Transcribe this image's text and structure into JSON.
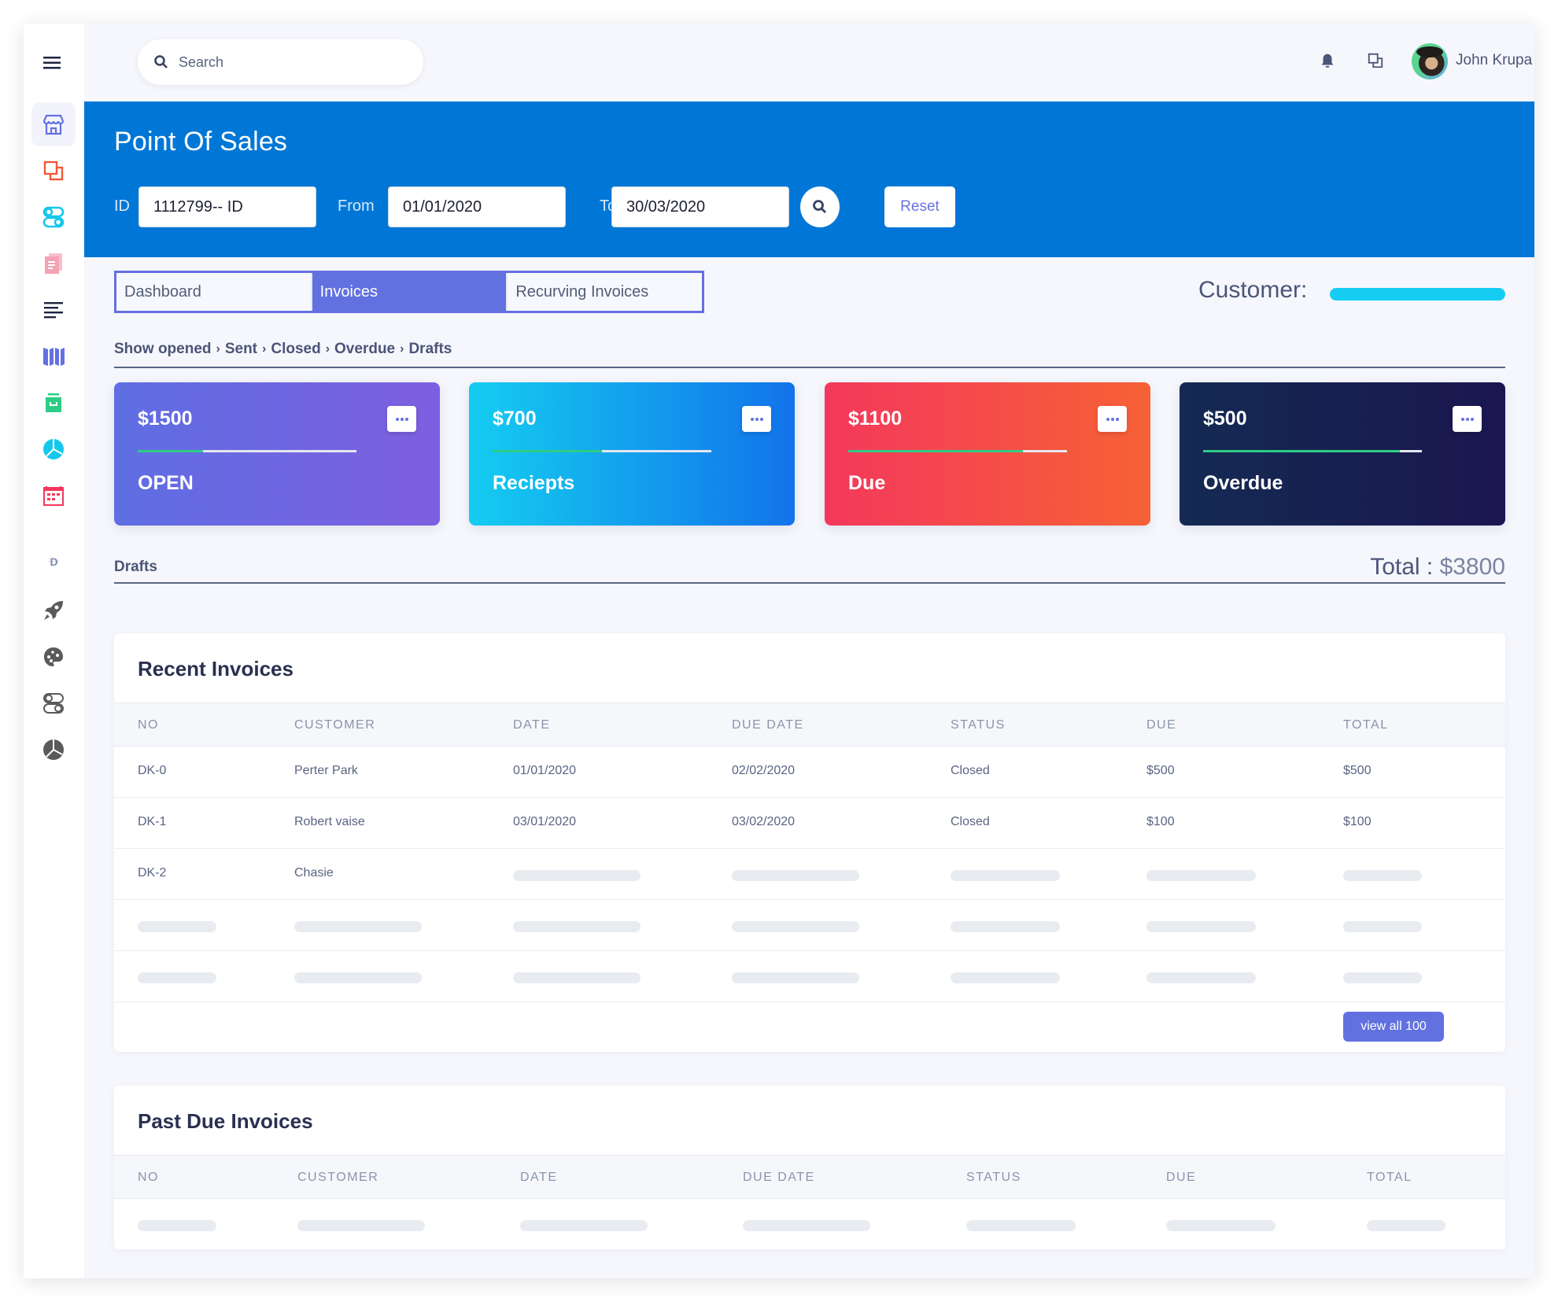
{
  "sidebar": {
    "menu_icon": "hamburger-icon",
    "items": [
      {
        "icon": "store-icon",
        "color": "#6470e0",
        "active": true
      },
      {
        "icon": "copy-icon",
        "color": "#f05a37"
      },
      {
        "icon": "toggles-icon",
        "color": "#14c8ec"
      },
      {
        "icon": "documents-icon",
        "color": "#f4a3b3"
      },
      {
        "icon": "align-left-icon",
        "color": "#1e2540"
      },
      {
        "icon": "map-icon",
        "color": "#6470e0"
      },
      {
        "icon": "archive-icon",
        "color": "#2ecc85"
      },
      {
        "icon": "pie-chart-icon",
        "color": "#14c8ec"
      },
      {
        "icon": "calendar-icon",
        "color": "#f4385c"
      }
    ],
    "section_letter": "D",
    "section_items": [
      {
        "icon": "rocket-icon",
        "color": "#5a5a5a"
      },
      {
        "icon": "palette-icon",
        "color": "#5a5a5a"
      },
      {
        "icon": "toggles-icon",
        "color": "#5a5a5a"
      },
      {
        "icon": "pie-chart-icon",
        "color": "#5a5a5a"
      }
    ]
  },
  "topbar": {
    "search_placeholder": "Search",
    "notification_icon": "bell-icon",
    "windows_icon": "copy-icon",
    "user_name": "John Krupa"
  },
  "banner": {
    "title": "Point Of Sales",
    "id_label": "ID",
    "id_value": "1112799-- ID",
    "from_label": "From",
    "from_value": "01/01/2020",
    "to_label": "To",
    "to_value": "30/03/2020",
    "reset_label": "Reset"
  },
  "tabs": [
    {
      "label": "Dashboard",
      "active": false
    },
    {
      "label": "Invoices",
      "active": true
    },
    {
      "label": "Recurving Invoices",
      "active": false
    }
  ],
  "customer_label": "Customer:",
  "breadcrumb": [
    "Show opened",
    "Sent",
    "Closed",
    "Overdue",
    "Drafts"
  ],
  "cards": [
    {
      "amount": "$1500",
      "label": "OPEN",
      "progress": 0.3
    },
    {
      "amount": "$700",
      "label": "Reciepts",
      "progress": 0.5
    },
    {
      "amount": "$1100",
      "label": "Due",
      "progress": 0.8
    },
    {
      "amount": "$500",
      "label": "Overdue",
      "progress": 0.9
    }
  ],
  "drafts": {
    "label": "Drafts",
    "total_prefix": "Total : ",
    "total_value": "$3800"
  },
  "recent_invoices": {
    "title": "Recent Invoices",
    "columns": [
      "NO",
      "CUSTOMER",
      "DATE",
      "DUE DATE",
      "STATUS",
      "DUE",
      "TOTAL"
    ],
    "rows": [
      {
        "no": "DK-0",
        "customer": "Perter Park",
        "date": "01/01/2020",
        "due_date": "02/02/2020",
        "status": "Closed",
        "due": "$500",
        "total": "$500"
      },
      {
        "no": "DK-1",
        "customer": "Robert vaise",
        "date": "03/01/2020",
        "due_date": "03/02/2020",
        "status": "Closed",
        "due": "$100",
        "total": "$100"
      },
      {
        "no": "DK-2",
        "customer": "Chasie",
        "date": null,
        "due_date": null,
        "status": null,
        "due": null,
        "total": null
      }
    ],
    "placeholder_rows": 2,
    "view_all_label": "view all 100"
  },
  "past_due_invoices": {
    "title": "Past Due Invoices",
    "columns": [
      "NO",
      "CUSTOMER",
      "DATE",
      "DUE DATE",
      "STATUS",
      "DUE",
      "TOTAL"
    ],
    "placeholder_rows": 1
  }
}
